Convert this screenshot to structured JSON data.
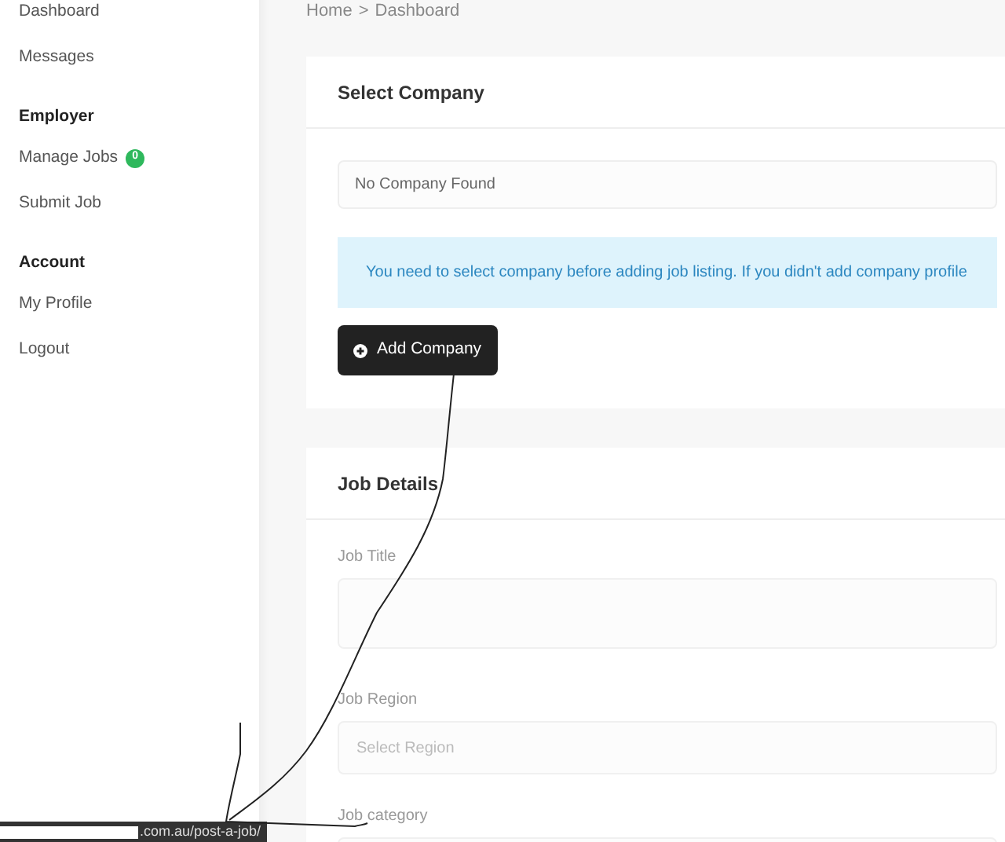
{
  "sidebar": {
    "items": [
      {
        "kind": "link",
        "label": "Dashboard"
      },
      {
        "kind": "link",
        "label": "Messages"
      },
      {
        "kind": "heading",
        "label": "Employer"
      },
      {
        "kind": "link",
        "label": "Manage Jobs",
        "badge": "0"
      },
      {
        "kind": "link",
        "label": "Submit Job"
      },
      {
        "kind": "heading",
        "label": "Account"
      },
      {
        "kind": "link",
        "label": "My Profile"
      },
      {
        "kind": "link",
        "label": "Logout"
      }
    ]
  },
  "breadcrumb": [
    "Home",
    ">",
    "Dashboard"
  ],
  "select_company": {
    "title": "Select Company",
    "field": {
      "value": "No Company Found"
    },
    "alert": "You need to select company before adding job listing. If you didn't add company profile",
    "button": "Add Company"
  },
  "job_details": {
    "title": "Job Details",
    "fields": [
      {
        "kind": "text",
        "label": "Job Title"
      },
      {
        "kind": "select",
        "label": "Job Region",
        "placeholder": "Select Region"
      },
      {
        "kind": "text",
        "label": "Job category"
      }
    ]
  },
  "status_bar": {
    "url": ".com.au/post-a-job/"
  }
}
